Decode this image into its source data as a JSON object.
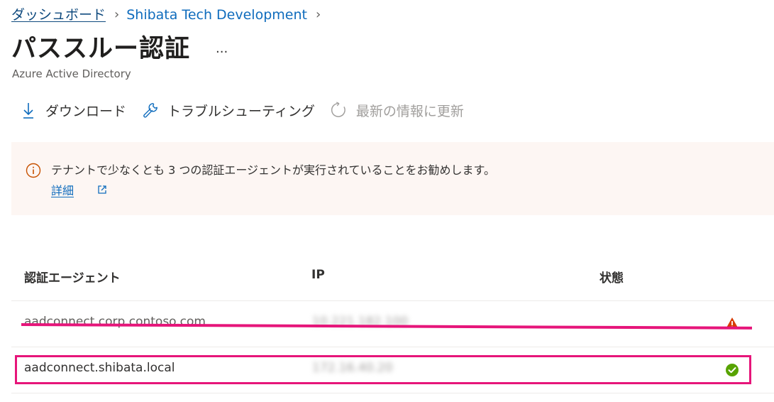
{
  "breadcrumb": {
    "items": [
      "ダッシュボード",
      "Shibata Tech Development"
    ]
  },
  "header": {
    "title": "パススルー認証",
    "more": "...",
    "subtitle": "Azure Active Directory"
  },
  "toolbar": {
    "download": "ダウンロード",
    "troubleshoot": "トラブルシューティング",
    "refresh": "最新の情報に更新"
  },
  "banner": {
    "message": "テナントで少なくとも 3 つの認証エージェントが実行されていることをお勧めします。",
    "link": "詳細"
  },
  "table": {
    "columns": [
      "認証エージェント",
      "IP",
      "状態"
    ],
    "rows": [
      {
        "agent": "aadconnect.corp.contoso.com",
        "ip": "10.221.182.100",
        "status": "warning-icon"
      },
      {
        "agent": "aadconnect.shibata.local",
        "ip": "172.16.40.20",
        "status": "check-icon"
      }
    ]
  },
  "colors": {
    "link": "#0f6cbd",
    "banner_bg": "#fdf6f3",
    "warning": "#d83b01",
    "success": "#57a300",
    "annotation": "#e6157a"
  }
}
